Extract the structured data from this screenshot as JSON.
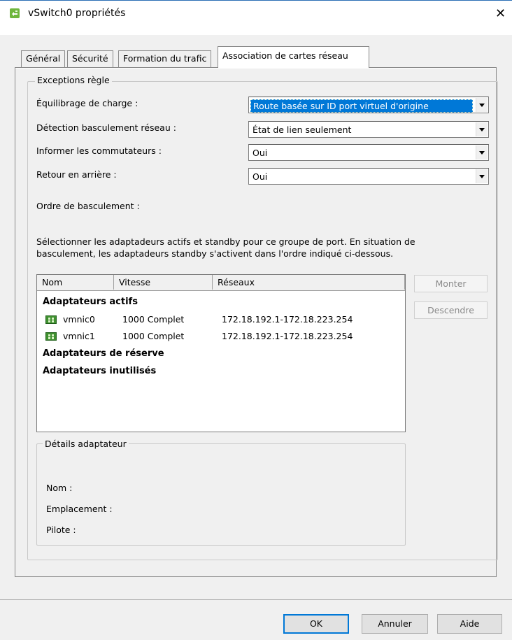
{
  "window": {
    "title": "vSwitch0 propriétés",
    "close_glyph": "✕"
  },
  "tabs": [
    {
      "label": "Général",
      "active": false
    },
    {
      "label": "Sécurité",
      "active": false
    },
    {
      "label": "Formation du trafic",
      "active": false
    },
    {
      "label": "Association de cartes réseau",
      "active": true
    }
  ],
  "exceptions": {
    "legend": "Exceptions règle",
    "fields": [
      {
        "label": "Équilibrage de charge :",
        "value": "Route basée sur ID port virtuel d'origine"
      },
      {
        "label": "Détection basculement réseau :",
        "value": "État de lien seulement"
      },
      {
        "label": "Informer les commutateurs :",
        "value": "Oui"
      },
      {
        "label": "Retour en arrière :",
        "value": "Oui"
      }
    ],
    "failover_label": "Ordre de basculement :",
    "description_line1": "Sélectionner les adaptadeurs actifs et standby pour ce groupe de port. En situation de",
    "description_line2": "basculement, les adaptadeurs standby s'activent dans l'ordre indiqué ci-dessous."
  },
  "adapter_list": {
    "columns": [
      "Nom",
      "Vitesse",
      "Réseaux"
    ],
    "groups": {
      "active": "Adaptateurs actifs",
      "standby": "Adaptateurs de réserve",
      "unused": "Adaptateurs inutilisés"
    },
    "adapters": [
      {
        "name": "vmnic0",
        "speed": "1000 Complet",
        "networks": "172.18.192.1-172.18.223.254",
        "icon": "nic-icon"
      },
      {
        "name": "vmnic1",
        "speed": "1000 Complet",
        "networks": "172.18.192.1-172.18.223.254",
        "icon": "nic-icon"
      }
    ]
  },
  "side_buttons": {
    "up": "Monter",
    "down": "Descendre"
  },
  "adapter_details": {
    "legend": "Détails adaptateur",
    "name_label": "Nom :",
    "location_label": "Emplacement :",
    "driver_label": "Pilote :"
  },
  "footer": {
    "ok": "OK",
    "cancel": "Annuler",
    "help": "Aide"
  },
  "colors": {
    "selection": "#0078d7",
    "dialog_bg": "#f0f0f0",
    "nic_icon": "#3e8f2f"
  }
}
